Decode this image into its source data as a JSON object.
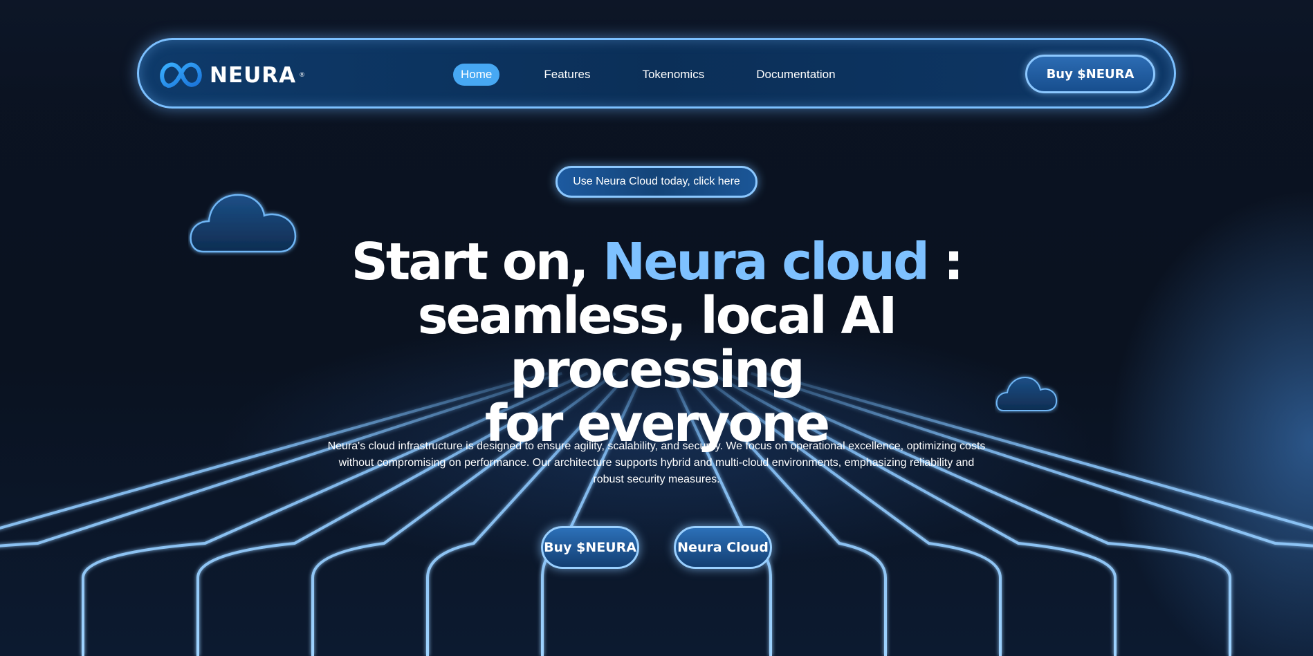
{
  "brand": {
    "name": "NEURA",
    "registered_mark": "®",
    "accent_color": "#7ec1ff",
    "highlight_color": "#47a8f3"
  },
  "nav": {
    "links": [
      {
        "label": "Home",
        "active": true
      },
      {
        "label": "Features",
        "active": false
      },
      {
        "label": "Tokenomics",
        "active": false
      },
      {
        "label": "Documentation",
        "active": false
      }
    ],
    "buy_label": "Buy $NEURA"
  },
  "hero": {
    "banner_label": "Use Neura Cloud today, click here",
    "headline_part1": "Start on, ",
    "headline_accent": "Neura cloud",
    "headline_part2": " :",
    "headline_line2": "seamless, local AI processing",
    "headline_line3": "for everyone",
    "description": "Neura's cloud infrastructure is designed to ensure agility, scalability, and security. We focus on operational excellence, optimizing costs without compromising on performance. Our architecture supports hybrid and multi-cloud environments, emphasizing reliability and robust security measures.",
    "cta_primary": "Buy $NEURA",
    "cta_secondary": "Neura Cloud"
  },
  "decor": {
    "icons": [
      "neura-logo-icon",
      "cloud-icon",
      "grid-floor"
    ]
  }
}
